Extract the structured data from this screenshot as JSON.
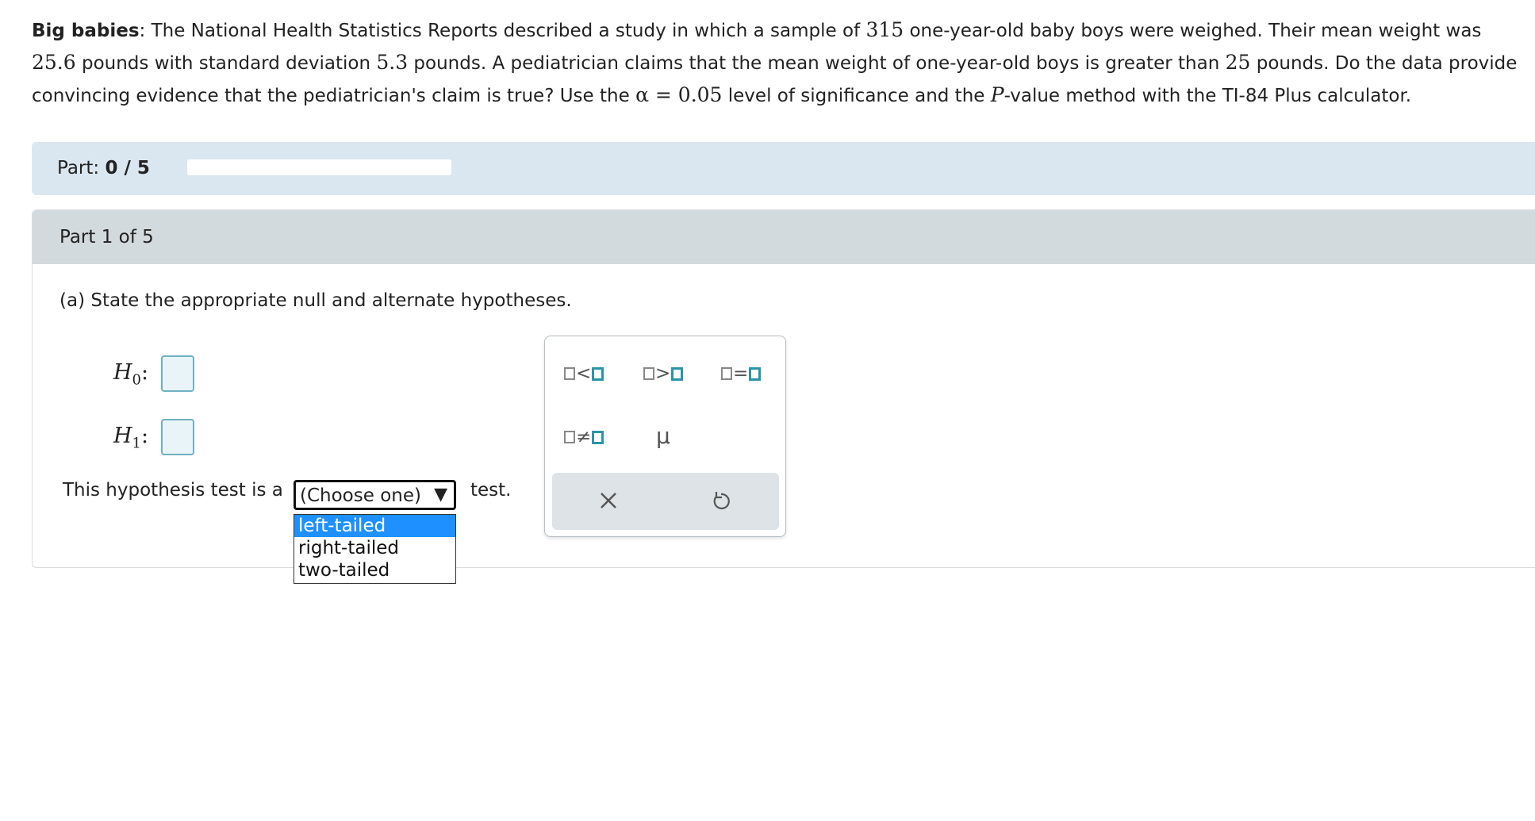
{
  "problem": {
    "title": "Big babies",
    "text_1": ": The National Health Statistics Reports described a study in which a sample of ",
    "sample_size": "315",
    "text_2": " one-year-old baby boys were weighed. Their mean weight was ",
    "mean": "25.6",
    "text_3": " pounds with standard deviation ",
    "sd": "5.3",
    "text_4": " pounds. A pediatrician claims that the mean weight of one-year-old boys is greater than ",
    "claim_value": "25",
    "text_5": " pounds. Do the data provide convincing evidence that the pediatrician's claim is true? Use the ",
    "alpha_expr": "α = 0.05",
    "text_6": " level of significance and the ",
    "p_letter": "P",
    "text_7": "-value method with the TI-84 Plus calculator."
  },
  "progress": {
    "label": "Part:",
    "value": "0 / 5",
    "fraction": 0
  },
  "part": {
    "title": "Part 1 of 5",
    "question": "(a) State the appropriate null and alternate hypotheses.",
    "h0_letter": "H",
    "h0_sub": "0",
    "h1_letter": "H",
    "h1_sub": "1",
    "colon": ":",
    "test_prefix": "This hypothesis test is a",
    "select_value": "(Choose one)",
    "select_arrow": "▼",
    "test_suffix": "test.",
    "options": [
      "left-tailed",
      "right-tailed",
      "two-tailed"
    ],
    "highlighted_option": "left-tailed"
  },
  "palette": {
    "lt": "<",
    "gt": ">",
    "eq": "=",
    "neq": "≠",
    "mu": "μ",
    "clear_icon": "x-icon",
    "undo_icon": "undo-icon"
  },
  "colors": {
    "accent_teal": "#2a95aa",
    "progress_bg": "#dbe7f0",
    "header_bg": "#d3dade",
    "highlight": "#1e90ff"
  }
}
